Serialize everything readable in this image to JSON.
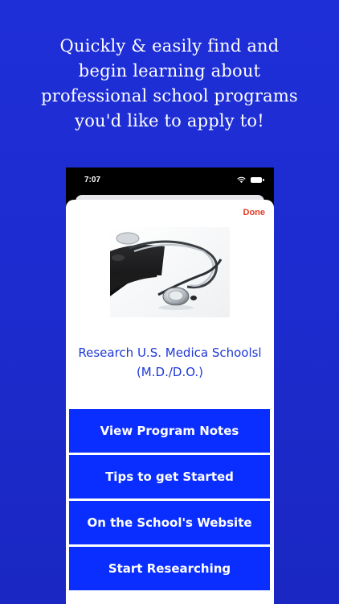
{
  "promo": {
    "line1": "Quickly & easily find and",
    "line2": "begin learning about",
    "line3": "professional school programs",
    "line4": "you'd like to apply to!"
  },
  "status_bar": {
    "time": "7:07"
  },
  "sheet": {
    "done_label": "Done",
    "title_line1": "Research U.S.  Medica Schoolsl",
    "title_line2": "(M.D./D.O.)",
    "buttons": [
      {
        "label": "View Program Notes"
      },
      {
        "label": "Tips to get Started"
      },
      {
        "label": "On the School's Website"
      },
      {
        "label": "Start Researching"
      }
    ]
  },
  "colors": {
    "background": "#1d2ccf",
    "button": "#0a2eff",
    "title": "#1e38d6",
    "done": "#e53b25"
  },
  "icons": [
    "wifi-icon",
    "battery-icon"
  ]
}
